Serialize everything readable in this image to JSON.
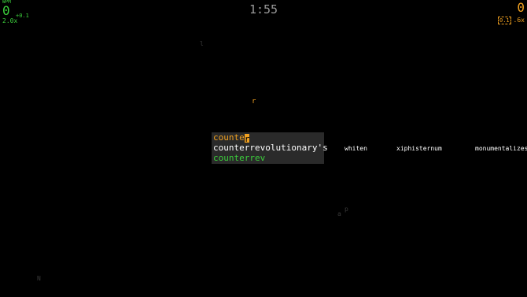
{
  "hud": {
    "left": {
      "label": "WPM",
      "score": "0",
      "delta": "+0.1",
      "multiplier": "2.0x"
    },
    "timer": "1:55",
    "right": {
      "score": "0",
      "badge": "0.1",
      "multiplier": ".6x"
    }
  },
  "drifting_letters": [
    "l",
    "r",
    "p",
    "a",
    "N"
  ],
  "active_word": {
    "typed": "counte",
    "cursor_char": "r",
    "target": "counterrevolutionary's",
    "progress": "counterrev"
  },
  "queue_words": [
    "whiten",
    "xiphisternum",
    "monumentalizes"
  ],
  "colors": {
    "player": "#3ccf3c",
    "opponent": "#f0a020",
    "panel": "#2a2a2a"
  }
}
